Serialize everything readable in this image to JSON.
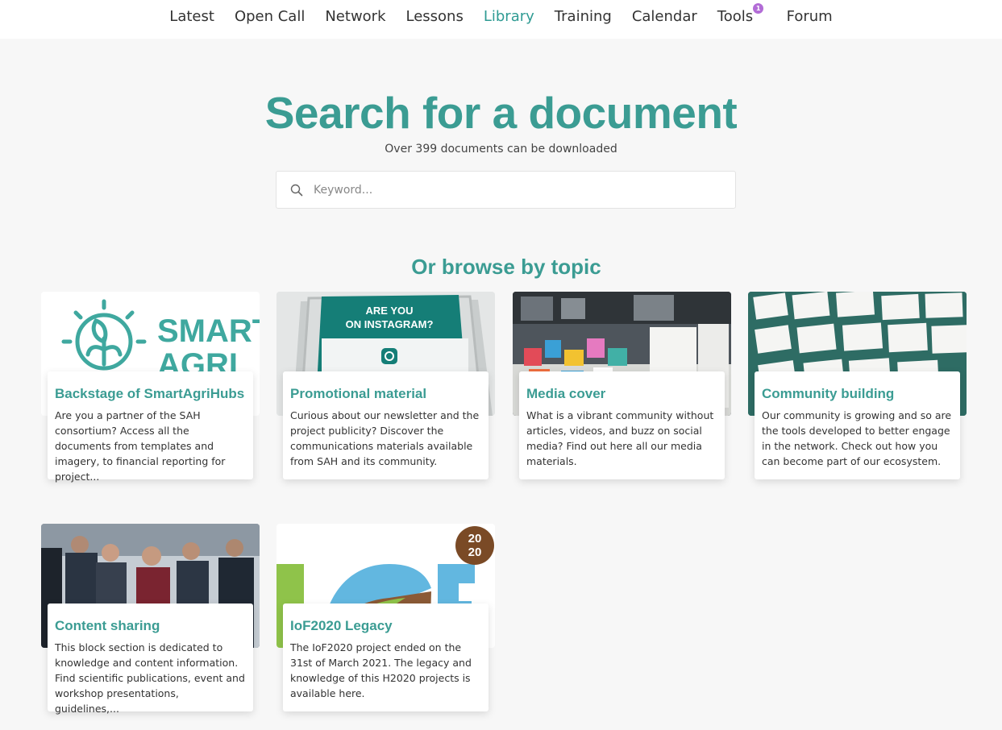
{
  "nav": {
    "items": [
      {
        "label": "Latest"
      },
      {
        "label": "Open Call"
      },
      {
        "label": "Network"
      },
      {
        "label": "Lessons"
      },
      {
        "label": "Library",
        "active": true
      },
      {
        "label": "Training"
      },
      {
        "label": "Calendar"
      },
      {
        "label": "Tools",
        "badge": "1"
      },
      {
        "label": "Forum"
      }
    ],
    "accent_color": "#2f9b93",
    "badge_color": "#b26cd6"
  },
  "hero": {
    "title": "Search for a document",
    "subtitle": "Over 399 documents can be downloaded"
  },
  "search": {
    "icon": "search-icon",
    "placeholder": "Keyword...",
    "value": ""
  },
  "browse": {
    "heading": "Or browse by topic",
    "topics": [
      {
        "title": "Backstage of SmartAgriHubs",
        "description": "Are you a partner of the SAH consortium? Access all the documents from templates and imagery, to financial reporting for project...",
        "image_text": [
          "SMART",
          "AGRI"
        ]
      },
      {
        "title": "Promotional material",
        "description": "Curious about our newsletter and the project publicity? Discover the communications materials available from SAH and its community.",
        "image_text": [
          "ARE YOU",
          "ON INSTAGRAM?"
        ]
      },
      {
        "title": "Media cover",
        "description": "What is a vibrant community without articles, videos, and buzz on social media? Find out here all our media materials."
      },
      {
        "title": "Community building",
        "description": "Our community is growing and so are the tools developed to better engage in the network. Check out how you can become part of our ecosystem."
      },
      {
        "title": "Content sharing",
        "description": "This block section is dedicated to knowledge and content information. Find scientific publications, event and workshop presentations, guidelines,..."
      },
      {
        "title": "IoF2020 Legacy",
        "description": "The IoF2020 project ended on the 31st of March 2021. The legacy and knowledge of this H2020 projects is available here.",
        "image_text": [
          "20",
          "20"
        ]
      }
    ]
  },
  "colors": {
    "heading": "#3b9c93",
    "background": "#f7f7f7"
  }
}
